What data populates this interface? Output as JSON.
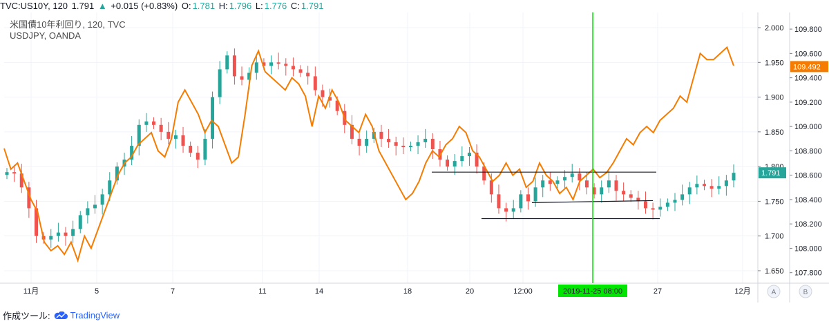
{
  "header": {
    "symbol": "TVC:US10Y, 120",
    "last": "1.791",
    "arrow": "▲",
    "change": "+0.015 (+0.83%)",
    "o_label": "O:",
    "o_val": "1.781",
    "h_label": "H:",
    "h_val": "1.796",
    "l_label": "L:",
    "l_val": "1.776",
    "c_label": "C:",
    "c_val": "1.791"
  },
  "legend": {
    "line1": "米国債10年利回り, 120, TVC",
    "line2": "USDJPY, OANDA"
  },
  "footer": {
    "made_with": "作成ツール:",
    "brand": "TradingView"
  },
  "colors": {
    "up": "#26a69a",
    "down": "#ef5350",
    "usdjpy": "#f57c00",
    "marker_line": "#00e600",
    "grid": "#f0f3fa",
    "trendline": "#131722"
  },
  "chart_data": {
    "type": "line",
    "x_ticks": [
      "11月",
      "5",
      "7",
      "11",
      "14",
      "18",
      "20",
      "12:00",
      "2019-11-25  08:00",
      "27",
      "12月"
    ],
    "y_left_ticks": [
      "2.000",
      "1.950",
      "1.900",
      "1.850",
      "1.800",
      "1.750",
      "1.700",
      "1.650"
    ],
    "y_right_ticks": [
      "109.800",
      "109.600",
      "109.400",
      "109.200",
      "109.000",
      "108.800",
      "108.600",
      "108.400",
      "108.200",
      "108.000",
      "107.800"
    ],
    "y_left_range": [
      1.642,
      2.012
    ],
    "y_right_range": [
      107.77,
      109.88
    ],
    "last_us10y_label": "1.791",
    "last_usdjpy_label": "109.492",
    "scale_buttons": [
      "A",
      "B"
    ],
    "series": [
      {
        "name": "USDJPY, OANDA",
        "axis": "right",
        "values": [
          108.82,
          108.65,
          108.7,
          108.55,
          108.4,
          108.3,
          108.05,
          107.98,
          108.02,
          107.95,
          108.05,
          107.9,
          108.1,
          108.0,
          108.15,
          108.3,
          108.45,
          108.6,
          108.7,
          108.75,
          108.85,
          108.9,
          108.95,
          108.8,
          108.75,
          108.9,
          109.2,
          109.3,
          109.2,
          109.1,
          108.95,
          109.05,
          109.0,
          108.85,
          108.7,
          108.75,
          109.1,
          109.5,
          109.62,
          109.45,
          109.4,
          109.35,
          109.3,
          109.4,
          109.35,
          109.25,
          109.0,
          109.25,
          109.15,
          109.3,
          109.2,
          109.05,
          109.0,
          108.95,
          109.1,
          109.0,
          108.8,
          108.7,
          108.6,
          108.5,
          108.4,
          108.45,
          108.55,
          108.7,
          108.8,
          108.75,
          108.85,
          108.9,
          109.0,
          108.95,
          108.8,
          108.75,
          108.65,
          108.55,
          108.6,
          108.7,
          108.6,
          108.65,
          108.5,
          108.55,
          108.7,
          108.6,
          108.55,
          108.45,
          108.5,
          108.4,
          108.55,
          108.6,
          108.65,
          108.58,
          108.62,
          108.7,
          108.8,
          108.9,
          108.85,
          108.95,
          109.0,
          108.95,
          109.05,
          109.1,
          109.15,
          109.25,
          109.2,
          109.4,
          109.6,
          109.55,
          109.55,
          109.6,
          109.65,
          109.5
        ]
      },
      {
        "name": "米国債10年利回り, 120, TVC",
        "axis": "left",
        "values": [
          1.792,
          1.79,
          1.77,
          1.74,
          1.7,
          1.695,
          1.7,
          1.705,
          1.7,
          1.71,
          1.73,
          1.74,
          1.745,
          1.76,
          1.78,
          1.8,
          1.81,
          1.83,
          1.86,
          1.865,
          1.86,
          1.85,
          1.84,
          1.845,
          1.83,
          1.82,
          1.81,
          1.84,
          1.9,
          1.94,
          1.96,
          1.93,
          1.925,
          1.935,
          1.95,
          1.945,
          1.95,
          1.948,
          1.945,
          1.94,
          1.935,
          1.93,
          1.91,
          1.9,
          1.895,
          1.88,
          1.86,
          1.84,
          1.83,
          1.84,
          1.85,
          1.84,
          1.835,
          1.83,
          1.828,
          1.83,
          1.835,
          1.84,
          1.825,
          1.81,
          1.8,
          1.808,
          1.815,
          1.82,
          1.8,
          1.78,
          1.76,
          1.74,
          1.735,
          1.74,
          1.76,
          1.75,
          1.77,
          1.78,
          1.775,
          1.78,
          1.785,
          1.79,
          1.78,
          1.77,
          1.76,
          1.77,
          1.78,
          1.765,
          1.76,
          1.755,
          1.75,
          1.74,
          1.738,
          1.742,
          1.748,
          1.752,
          1.76,
          1.77,
          1.775,
          1.772,
          1.768,
          1.772,
          1.78,
          1.791
        ]
      }
    ],
    "horizontal_lines": [
      {
        "value": 1.792,
        "from": "18",
        "to": "27"
      },
      {
        "value": 1.748,
        "from": "12:00",
        "to": "27"
      },
      {
        "value": 1.725,
        "from": "20",
        "to": "27"
      }
    ],
    "marker_time": "2019-11-25  08:00"
  }
}
